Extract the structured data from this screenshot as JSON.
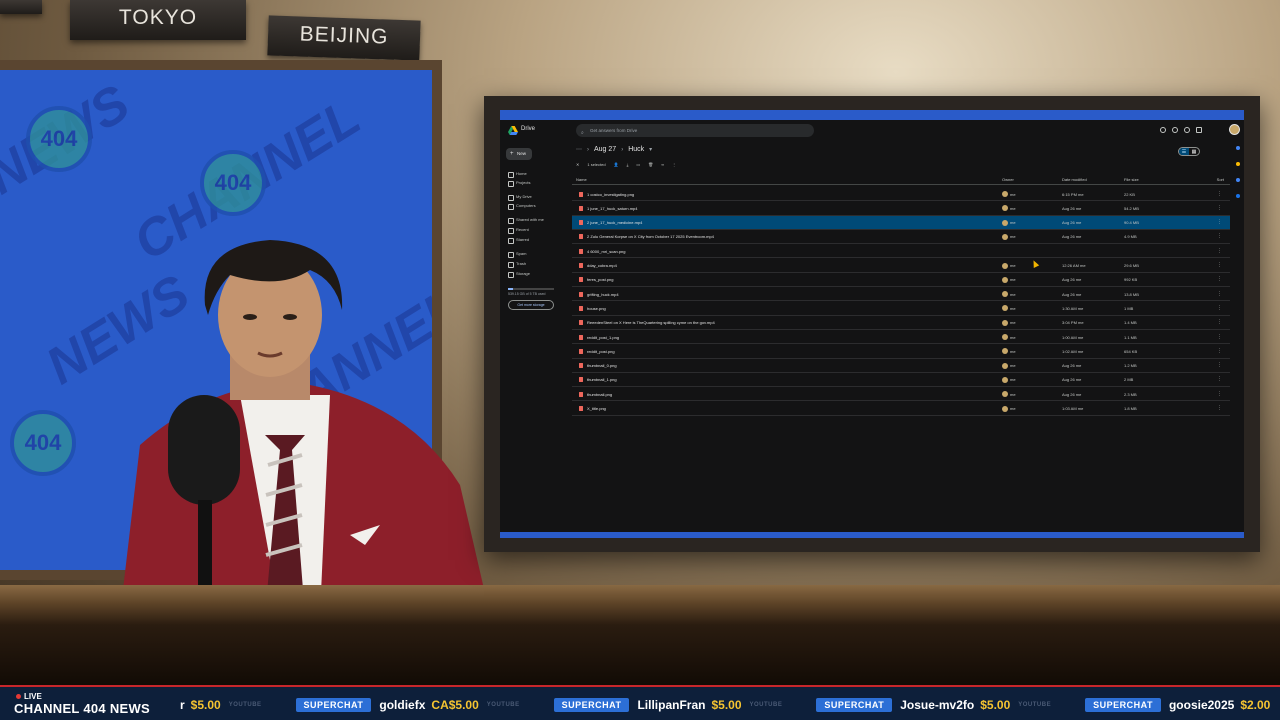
{
  "scene": {
    "signs": [
      "TOKYO",
      "BEIJING"
    ],
    "wall_watermark": [
      "NEWS",
      "CHANNEL",
      "404"
    ]
  },
  "drive": {
    "app_name": "Drive",
    "search_placeholder": "Get answers from Drive",
    "new_label": "New",
    "sidebar": [
      "Home",
      "Projects",
      "My Drive",
      "Computers",
      "Shared with me",
      "Recent",
      "Starred",
      "Spam",
      "Trash",
      "Storage"
    ],
    "storage_text": "539.15 GB of 5 TB used",
    "storage_fraction": 0.11,
    "get_storage": "Get more storage",
    "breadcrumb": [
      "Aug 27",
      "Huck"
    ],
    "selection_text": "1 selected",
    "columns": {
      "name": "Name",
      "owner": "Owner",
      "modified": "Date modified",
      "size": "File size",
      "sort": "Sort"
    },
    "files": [
      {
        "name": "1 costco_investigating.png",
        "type": "image",
        "owner": "me",
        "modified": "6:15 PM me",
        "size": "22 KB"
      },
      {
        "name": "1 june_17_huck_saturn.mp4",
        "type": "video",
        "owner": "me",
        "modified": "Aug 26 me",
        "size": "54.2 MB"
      },
      {
        "name": "2 june_17_huck_medicine.mp4",
        "type": "video",
        "owner": "me",
        "modified": "Aug 26 me",
        "size": "90.4 MB",
        "selected": true
      },
      {
        "name": "2 Zulu General Korpse on X City from October 17 2025 Eventroom.mp4",
        "type": "video",
        "owner": "me",
        "modified": "Aug 26 me",
        "size": "4.9 MB"
      },
      {
        "name": "4 6000_mri_scan.png",
        "type": "image",
        "owner": "",
        "modified": "",
        "size": ""
      },
      {
        "name": "dday_cobra.mp4",
        "type": "video",
        "owner": "me",
        "modified": "12:26 AM me",
        "size": "29.6 MB"
      },
      {
        "name": "feres_post.png",
        "type": "image",
        "owner": "me",
        "modified": "Aug 26 me",
        "size": "992 KB"
      },
      {
        "name": "grifting_huck.mp4",
        "type": "video",
        "owner": "me",
        "modified": "Aug 26 me",
        "size": "13.8 MB"
      },
      {
        "name": "house.png",
        "type": "image",
        "owner": "me",
        "modified": "1:30 AM me",
        "size": "1 MB"
      },
      {
        "name": "ReeedenSteel on X Here is TheQuartering spilling cyme on the gov.mp4",
        "type": "video",
        "owner": "me",
        "modified": "3:04 PM me",
        "size": "1.4 MB"
      },
      {
        "name": "reddit_post_1.png",
        "type": "image",
        "owner": "me",
        "modified": "1:00 AM me",
        "size": "1.1 MB"
      },
      {
        "name": "reddit_post.png",
        "type": "image",
        "owner": "me",
        "modified": "1:02 AM me",
        "size": "654 KB"
      },
      {
        "name": "thumbnail_0.png",
        "type": "image",
        "owner": "me",
        "modified": "Aug 26 me",
        "size": "1.2 MB"
      },
      {
        "name": "thumbnail_1.png",
        "type": "image",
        "owner": "me",
        "modified": "Aug 26 me",
        "size": "2 MB"
      },
      {
        "name": "thumbnail.png",
        "type": "image",
        "owner": "me",
        "modified": "Aug 26 me",
        "size": "2.3 MB"
      },
      {
        "name": "X_title.png",
        "type": "image",
        "owner": "me",
        "modified": "1:03 AM me",
        "size": "1.8 MB"
      }
    ]
  },
  "ticker": {
    "live": "LIVE",
    "channel": "CHANNEL 404 NEWS",
    "items": [
      {
        "badge": "",
        "name": "r",
        "amount": "$5.00",
        "source": "YOUTUBE"
      },
      {
        "badge": "SUPERCHAT",
        "name": "goldiefx",
        "amount": "CA$5.00",
        "source": "YOUTUBE"
      },
      {
        "badge": "SUPERCHAT",
        "name": "LillipanFran",
        "amount": "$5.00",
        "source": "YOUTUBE"
      },
      {
        "badge": "SUPERCHAT",
        "name": "Josue-mv2fo",
        "amount": "$5.00",
        "source": "YOUTUBE"
      },
      {
        "badge": "SUPERCHAT",
        "name": "goosie2025",
        "amount": "$2.00",
        "source": ""
      }
    ]
  }
}
